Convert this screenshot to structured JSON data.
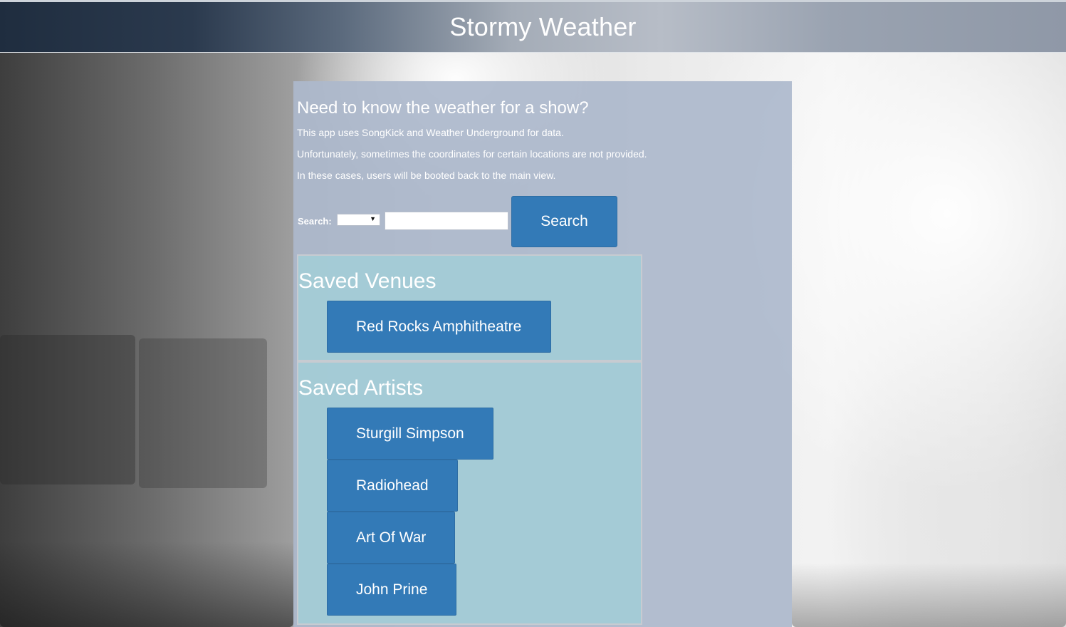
{
  "header": {
    "title": "Stormy Weather"
  },
  "intro": {
    "heading": "Need to know the weather for a show?",
    "lines": [
      "This app uses SongKick and Weather Underground for data.",
      "Unfortunately, sometimes the coordinates for certain locations are not provided.",
      "In these cases, users will be booted back to the main view."
    ]
  },
  "search": {
    "label": "Search:",
    "select_value": "",
    "input_value": "",
    "input_placeholder": "",
    "button_label": "Search"
  },
  "saved_venues": {
    "title": "Saved Venues",
    "items": [
      {
        "label": "Red Rocks Amphitheatre"
      }
    ]
  },
  "saved_artists": {
    "title": "Saved Artists",
    "items": [
      {
        "label": "Sturgill Simpson"
      },
      {
        "label": "Radiohead"
      },
      {
        "label": "Art Of War"
      },
      {
        "label": "John Prine"
      }
    ]
  },
  "colors": {
    "button": "#337ab7",
    "panel": "#acb8cc",
    "section": "#a3cbd6"
  }
}
